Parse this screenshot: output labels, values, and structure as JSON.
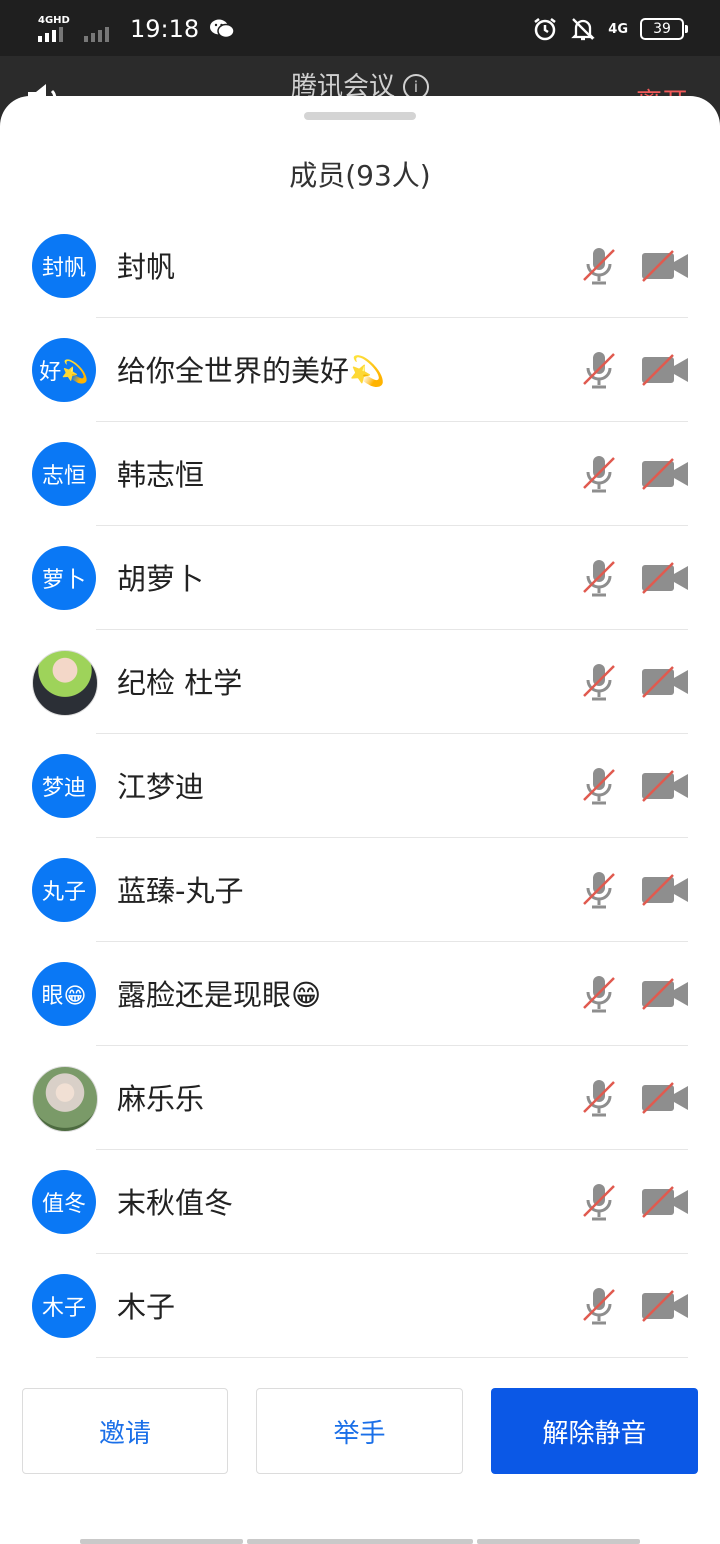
{
  "status_bar": {
    "network_tag": "4GHD",
    "time": "19:18",
    "right_network": "4G",
    "battery": "39",
    "icons": [
      "signal-icon",
      "wechat-icon",
      "alarm-icon",
      "bell-off-icon",
      "battery-icon"
    ]
  },
  "header": {
    "title": "腾讯会议",
    "info_glyph": "i",
    "leave": "离开"
  },
  "panel": {
    "title": "成员(93人)"
  },
  "members": [
    {
      "avatar_text": "封帆",
      "name": "封帆",
      "mic": "muted",
      "camera": "off"
    },
    {
      "avatar_text": "好💫",
      "name": "给你全世界的美好💫",
      "mic": "muted",
      "camera": "off"
    },
    {
      "avatar_text": "志恒",
      "name": "韩志恒",
      "mic": "muted",
      "camera": "off"
    },
    {
      "avatar_text": "萝卜",
      "name": "胡萝卜",
      "mic": "muted",
      "camera": "off"
    },
    {
      "avatar_text": "",
      "name": "纪检 杜学",
      "mic": "muted",
      "camera": "off"
    },
    {
      "avatar_text": "梦迪",
      "name": "江梦迪",
      "mic": "muted",
      "camera": "off"
    },
    {
      "avatar_text": "丸子",
      "name": "蓝臻-丸子",
      "mic": "muted",
      "camera": "off"
    },
    {
      "avatar_text": "眼😁",
      "name": "露脸还是现眼😁",
      "mic": "muted",
      "camera": "off"
    },
    {
      "avatar_text": "",
      "name": "麻乐乐",
      "mic": "muted",
      "camera": "off"
    },
    {
      "avatar_text": "值冬",
      "name": "末秋值冬",
      "mic": "muted",
      "camera": "off"
    },
    {
      "avatar_text": "木子",
      "name": "木子",
      "mic": "muted",
      "camera": "off"
    }
  ],
  "buttons": {
    "invite": "邀请",
    "raise_hand": "举手",
    "unmute": "解除静音"
  },
  "colors": {
    "accent": "#0b58e6",
    "avatar_bg": "#0a78f5",
    "leave_red": "#f25a5a",
    "mute_slash": "#e05a4f",
    "icon_gray": "#8e8e8e"
  }
}
